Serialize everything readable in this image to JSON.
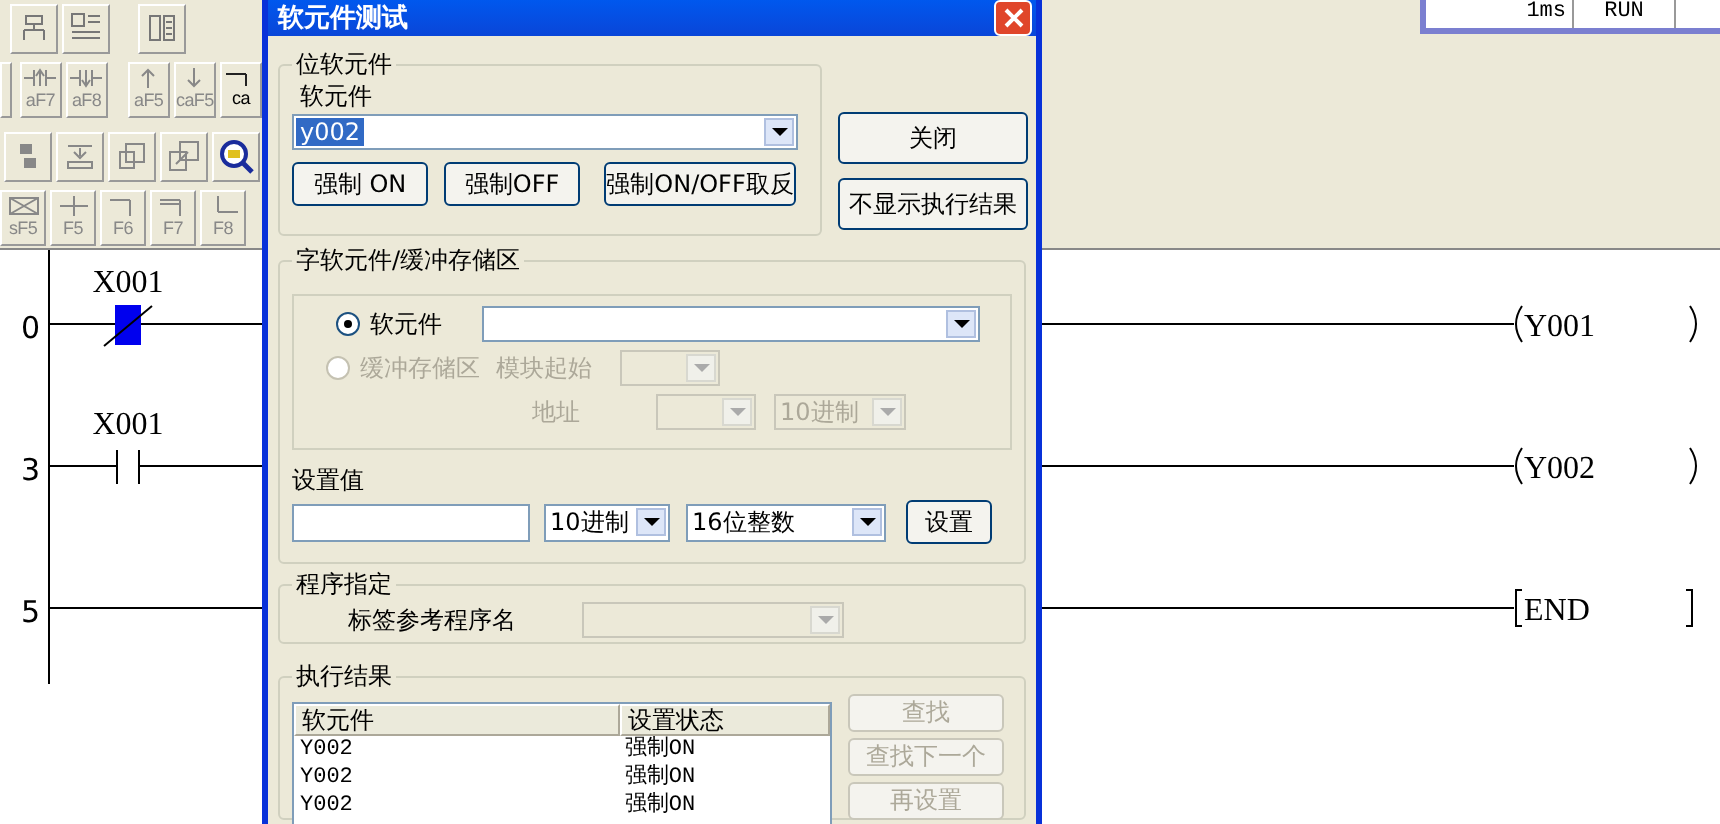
{
  "toolbar": {
    "key_rows": [
      [
        {
          "kind": "partial"
        },
        {
          "kind": "rising",
          "key": "aF7"
        },
        {
          "kind": "falling",
          "key": "aF8"
        },
        {
          "kind": "up",
          "key": "aF5"
        },
        {
          "kind": "down",
          "key": "caF5"
        },
        {
          "kind": "wire",
          "key": "ca"
        }
      ],
      [
        {
          "kind": "invert",
          "key": "sF5"
        },
        {
          "kind": "contact",
          "key": "F5"
        },
        {
          "kind": "nc",
          "key": "F6"
        },
        {
          "kind": "parallel",
          "key": "F7"
        },
        {
          "kind": "parallel-nc",
          "key": "F8"
        }
      ]
    ]
  },
  "status_panel": {
    "cells": [
      "1ms",
      "RUN"
    ]
  },
  "ladder": {
    "rungs": [
      {
        "step": "0",
        "contact": {
          "kind": "nc",
          "label": "X001",
          "on": true
        },
        "output": {
          "kind": "coil",
          "label": "Y001"
        }
      },
      {
        "step": "3",
        "contact": {
          "kind": "no",
          "label": "X001",
          "on": false
        },
        "output": {
          "kind": "coil",
          "label": "Y002"
        }
      },
      {
        "step": "5",
        "output": {
          "kind": "end",
          "label": "END"
        }
      }
    ]
  },
  "dialog": {
    "title": "软元件测试",
    "bit_device": {
      "title": "位软元件",
      "label": "软元件",
      "value": "y002",
      "buttons": [
        "强制 ON",
        "强制OFF",
        "强制ON/OFF取反"
      ]
    },
    "side_buttons": [
      "关闭",
      "不显示执行结果"
    ],
    "word_device": {
      "title": "字软元件/缓冲存储区",
      "options": [
        {
          "label": "软元件",
          "selected": true,
          "disabled": false
        },
        {
          "label": "缓冲存储区",
          "selected": false,
          "disabled": true
        }
      ],
      "module_start_label": "模块起始",
      "address_label": "地址",
      "radix": "10进制",
      "set_value_label": "设置值",
      "set_radix": "10进制",
      "data_type": "16位整数",
      "set_button": "设置"
    },
    "program": {
      "title": "程序指定",
      "label": "标签参考程序名"
    },
    "results": {
      "title": "执行结果",
      "columns": [
        "软元件",
        "设置状态"
      ],
      "rows": [
        [
          "Y002",
          "强制ON"
        ],
        [
          "Y002",
          "强制ON"
        ],
        [
          "Y002",
          "强制ON"
        ]
      ],
      "buttons": [
        {
          "label": "查找",
          "disabled": true
        },
        {
          "label": "查找下一个",
          "disabled": true
        },
        {
          "label": "再设置",
          "disabled": true
        }
      ]
    }
  }
}
